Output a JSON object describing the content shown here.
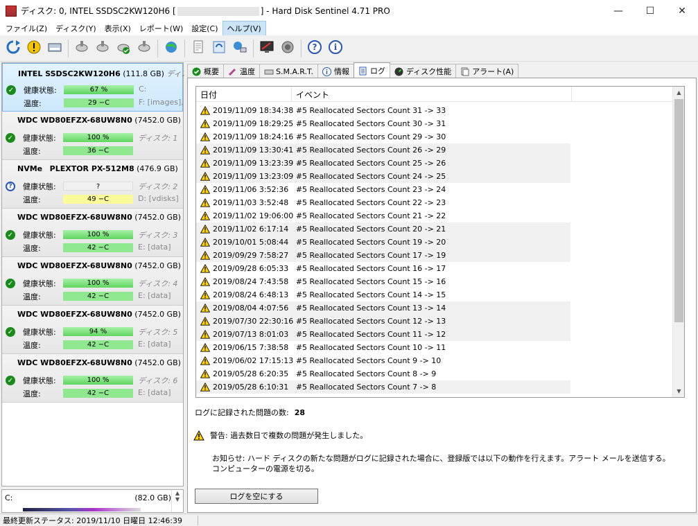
{
  "window": {
    "title_prefix": "ディスク: 0, INTEL SSDSC2KW120H6 [",
    "title_suffix": "]  -  Hard Disk Sentinel 4.71 PRO",
    "minimize": "—",
    "maximize": "☐",
    "close": "✕"
  },
  "menu": [
    {
      "label": "ファイル(Z)"
    },
    {
      "label": "ディスク(Y)"
    },
    {
      "label": "表示(X)"
    },
    {
      "label": "レポート(W)"
    },
    {
      "label": "設定(C)"
    },
    {
      "label": "ヘルプ(V)",
      "active": true
    }
  ],
  "toolbar": [
    {
      "name": "refresh",
      "icon": "refresh-icon"
    },
    {
      "name": "alert",
      "icon": "alert-icon"
    },
    {
      "name": "disk-info",
      "icon": "disk-icon"
    },
    {
      "name": "sep1",
      "icon": "sep"
    },
    {
      "name": "disk-test-1",
      "icon": "disk-test-icon"
    },
    {
      "name": "disk-test-2",
      "icon": "disk-test-icon"
    },
    {
      "name": "disk-test-3",
      "icon": "disk-test-ok-icon"
    },
    {
      "name": "disk-test-4",
      "icon": "disk-test-icon"
    },
    {
      "name": "sep2",
      "icon": "sep"
    },
    {
      "name": "web-report",
      "icon": "globe-icon"
    },
    {
      "name": "sep3",
      "icon": "sep"
    },
    {
      "name": "report",
      "icon": "report-icon"
    },
    {
      "name": "sync",
      "icon": "sync-icon"
    },
    {
      "name": "network",
      "icon": "network-icon"
    },
    {
      "name": "sep4",
      "icon": "sep"
    },
    {
      "name": "monitor",
      "icon": "monitor-icon"
    },
    {
      "name": "sound",
      "icon": "speaker-icon"
    },
    {
      "name": "sep5",
      "icon": "sep"
    },
    {
      "name": "help",
      "icon": "help-icon"
    },
    {
      "name": "info",
      "icon": "info-icon"
    }
  ],
  "disks": [
    {
      "model": "INTEL SSDSC2KW120H6",
      "size": "(111.8 GB)",
      "disk_label": "ディスク:",
      "health_label": "健康状態:",
      "health": "67 %",
      "health_level": 0.67,
      "temp_label": "温度:",
      "temp": "29 −C",
      "drive1": "C:",
      "drive2": "F: [images],",
      "status": "ok",
      "selected": true,
      "prefix": ""
    },
    {
      "model": "WDC WD80EFZX-68UW8N0",
      "size": "(7452.0 GB)",
      "disk_label": "",
      "health_label": "健康状態:",
      "health": "100 %",
      "health_level": 1.0,
      "temp_label": "温度:",
      "temp": "36 −C",
      "drive1": "ディスク: 1",
      "drive2": "",
      "status": "ok",
      "selected": false,
      "prefix": ""
    },
    {
      "model": "PLEXTOR PX-512M8",
      "size": "(476.9 GB)",
      "disk_label": "",
      "health_label": "健康状態:",
      "health": "?",
      "health_level": 0,
      "temp_label": "温度:",
      "temp": "49 −C",
      "drive1": "ディスク: 2",
      "drive2": "D: [vdisks]",
      "status": "unknown",
      "selected": false,
      "prefix": "NVMe"
    },
    {
      "model": "WDC WD80EFZX-68UW8N0",
      "size": "(7452.0 GB)",
      "disk_label": "",
      "health_label": "健康状態:",
      "health": "100 %",
      "health_level": 1.0,
      "temp_label": "温度:",
      "temp": "42 −C",
      "drive1": "ディスク: 3",
      "drive2": "E: [data]",
      "status": "ok",
      "selected": false,
      "prefix": ""
    },
    {
      "model": "WDC WD80EFZX-68UW8N0",
      "size": "(7452.0 GB)",
      "disk_label": "",
      "health_label": "健康状態:",
      "health": "100 %",
      "health_level": 1.0,
      "temp_label": "温度:",
      "temp": "42 −C",
      "drive1": "ディスク: 4",
      "drive2": "E: [data]",
      "status": "ok",
      "selected": false,
      "prefix": ""
    },
    {
      "model": "WDC WD80EFZX-68UW8N0",
      "size": "(7452.0 GB)",
      "disk_label": "",
      "health_label": "健康状態:",
      "health": "94 %",
      "health_level": 0.94,
      "temp_label": "温度:",
      "temp": "42 −C",
      "drive1": "ディスク: 5",
      "drive2": "E: [data]",
      "status": "ok",
      "selected": false,
      "prefix": ""
    },
    {
      "model": "WDC WD80EFZX-68UW8N0",
      "size": "(7452.0 GB)",
      "disk_label": "",
      "health_label": "健康状態:",
      "health": "100 %",
      "health_level": 1.0,
      "temp_label": "温度:",
      "temp": "42 −C",
      "drive1": "ディスク: 6",
      "drive2": "E: [data]",
      "status": "ok",
      "selected": false,
      "prefix": ""
    }
  ],
  "volume": {
    "drive": "C:",
    "size": "(82.0 GB)"
  },
  "tabs": [
    {
      "label": "概要",
      "icon": "check-icon"
    },
    {
      "label": "温度",
      "icon": "thermometer-icon"
    },
    {
      "label": "S.M.A.R.T.",
      "icon": "disk-icon"
    },
    {
      "label": "情報",
      "icon": "info-icon"
    },
    {
      "label": "ログ",
      "icon": "log-icon",
      "active": true
    },
    {
      "label": "ディスク性能",
      "icon": "performance-icon"
    },
    {
      "label": "アラート(A)",
      "icon": "alert-page-icon"
    }
  ],
  "log": {
    "col_date": "日付",
    "col_event": "イベント",
    "rows": [
      {
        "date": "2019/11/09 18:34:38",
        "event": "#5   Reallocated Sectors Count  31 -> 33"
      },
      {
        "date": "2019/11/09 18:29:25",
        "event": "#5   Reallocated Sectors Count  30 -> 31"
      },
      {
        "date": "2019/11/09 18:24:16",
        "event": "#5   Reallocated Sectors Count  29 -> 30"
      },
      {
        "date": "2019/11/09 13:30:41",
        "event": "#5   Reallocated Sectors Count  26 -> 29"
      },
      {
        "date": "2019/11/09 13:23:39",
        "event": "#5   Reallocated Sectors Count  25 -> 26"
      },
      {
        "date": "2019/11/09 13:23:09",
        "event": "#5   Reallocated Sectors Count  24 -> 25"
      },
      {
        "date": "2019/11/06 3:52:36",
        "event": "#5   Reallocated Sectors Count  23 -> 24"
      },
      {
        "date": "2019/11/03 3:52:48",
        "event": "#5   Reallocated Sectors Count  22 -> 23"
      },
      {
        "date": "2019/11/02 19:06:00",
        "event": "#5   Reallocated Sectors Count  21 -> 22"
      },
      {
        "date": "2019/11/02 6:17:14",
        "event": "#5   Reallocated Sectors Count  20 -> 21"
      },
      {
        "date": "2019/10/01 5:08:44",
        "event": "#5   Reallocated Sectors Count  19 -> 20"
      },
      {
        "date": "2019/09/29 7:58:27",
        "event": "#5   Reallocated Sectors Count  17 -> 19"
      },
      {
        "date": "2019/09/28 6:05:33",
        "event": "#5   Reallocated Sectors Count  16 -> 17"
      },
      {
        "date": "2019/08/24 7:43:58",
        "event": "#5   Reallocated Sectors Count  15 -> 16"
      },
      {
        "date": "2019/08/24 6:48:13",
        "event": "#5   Reallocated Sectors Count  14 -> 15"
      },
      {
        "date": "2019/08/04 4:07:56",
        "event": "#5   Reallocated Sectors Count  13 -> 14"
      },
      {
        "date": "2019/07/30 22:30:16",
        "event": "#5   Reallocated Sectors Count  12 -> 13"
      },
      {
        "date": "2019/07/13 8:01:03",
        "event": "#5   Reallocated Sectors Count  11 -> 12"
      },
      {
        "date": "2019/06/15 7:38:58",
        "event": "#5   Reallocated Sectors Count  10 -> 11"
      },
      {
        "date": "2019/06/02 17:15:13",
        "event": "#5   Reallocated Sectors Count  9 -> 10"
      },
      {
        "date": "2019/05/28 6:20:35",
        "event": "#5   Reallocated Sectors Count  8 -> 9"
      },
      {
        "date": "2019/05/28 6:10:31",
        "event": "#5   Reallocated Sectors Count  7 -> 8"
      }
    ]
  },
  "summary": {
    "label": "ログに記録された問題の数:",
    "count": "28"
  },
  "warning": "警告: 過去数日で複数の問題が発生しました。",
  "notice": "お知らせ: ハード ディスクの新たな問題がログに記録された場合に、登録版では以下の動作を行えます。アラート メールを送信する。コンピューターの電源を切る。",
  "clear_button": "ログを空にする",
  "status_bar": "最終更新ステータス: 2019/11/10 日曜日 12:46:39",
  "colors": {
    "health_green": "#5fd55f",
    "temp_yellow": "#fafa9a",
    "warning": "#ffd400",
    "selected": "#cde8fb"
  }
}
